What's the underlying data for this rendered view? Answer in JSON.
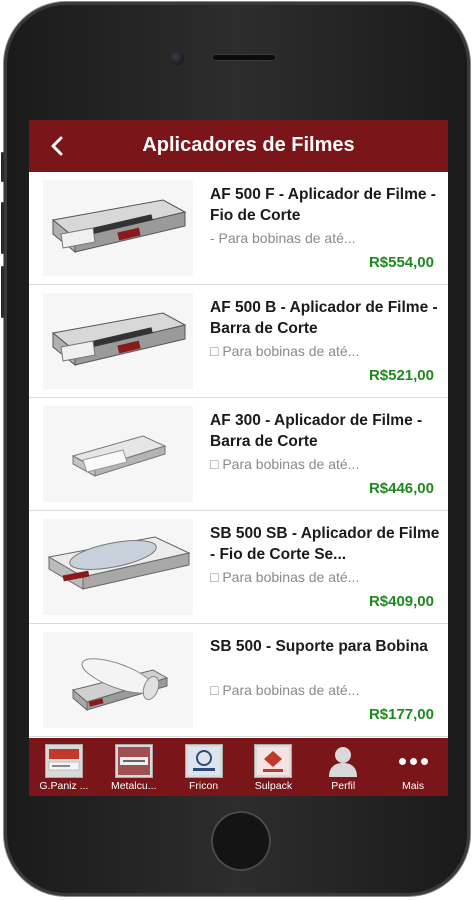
{
  "header": {
    "back_glyph": "‹",
    "title": "Aplicadores de Filmes"
  },
  "products": [
    {
      "name": "AF 500 F - Aplicador de Filme - Fio de Corte",
      "description": "- Para bobinas de até...",
      "price": "R$554,00",
      "image": "film-applicator-wire-cut"
    },
    {
      "name": "AF 500 B - Aplicador de Filme - Barra de Corte",
      "description": "□ Para bobinas de até...",
      "price": "R$521,00",
      "image": "film-applicator-bar-cut"
    },
    {
      "name": "AF 300 - Aplicador de Filme - Barra de Corte",
      "description": "□ Para bobinas de até...",
      "price": "R$446,00",
      "image": "small-film-applicator"
    },
    {
      "name": "SB 500 SB - Aplicador de Filme - Fio de Corte Se...",
      "description": "□ Para bobinas de até...",
      "price": "R$409,00",
      "image": "film-applicator-with-roll"
    },
    {
      "name": "SB 500 - Suporte para Bobina",
      "description": "□ Para bobinas de até...",
      "price": "R$177,00",
      "image": "roll-support"
    }
  ],
  "tabbar": {
    "tabs": [
      {
        "label": "G.Paniz ...",
        "icon": "gpaniz-logo-icon"
      },
      {
        "label": "Metalcu...",
        "icon": "metalcubo-logo-icon"
      },
      {
        "label": "Fricon",
        "icon": "fricon-logo-icon"
      },
      {
        "label": "Sulpack",
        "icon": "sulpack-logo-icon"
      },
      {
        "label": "Perfil",
        "icon": "person-icon"
      },
      {
        "label": "Mais",
        "icon": "more-dots-icon"
      }
    ]
  },
  "colors": {
    "brand": "#7a1619",
    "price": "#1e8a1e"
  }
}
